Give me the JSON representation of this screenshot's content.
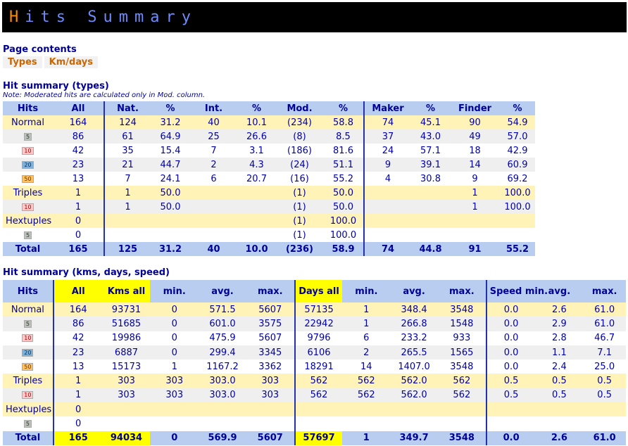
{
  "banner": {
    "title_first": "H",
    "title_rest": "its Summary"
  },
  "page_contents": {
    "heading": "Page contents",
    "tabs": [
      "Types",
      "Km/days"
    ]
  },
  "types": {
    "heading": "Hit summary (types)",
    "note": "Note: Moderated hits are calculated only in Mod. column.",
    "headers": [
      "Hits",
      "All",
      "Nat.",
      "%",
      "Int.",
      "%",
      "Mod.",
      "%",
      "Maker",
      "%",
      "Finder",
      "%"
    ],
    "rows": [
      {
        "label": "Normal",
        "badge": "",
        "style": "yellow",
        "cells": [
          "164",
          "124",
          "31.2",
          "40",
          "10.1",
          "(234)",
          "58.8",
          "74",
          "45.1",
          "90",
          "54.9"
        ]
      },
      {
        "label": "",
        "badge": "5",
        "style": "grey",
        "cells": [
          "86",
          "61",
          "64.9",
          "25",
          "26.6",
          "(8)",
          "8.5",
          "37",
          "43.0",
          "49",
          "57.0"
        ]
      },
      {
        "label": "",
        "badge": "10",
        "style": "white",
        "cells": [
          "42",
          "35",
          "15.4",
          "7",
          "3.1",
          "(186)",
          "81.6",
          "24",
          "57.1",
          "18",
          "42.9"
        ]
      },
      {
        "label": "",
        "badge": "20",
        "style": "grey",
        "cells": [
          "23",
          "21",
          "44.7",
          "2",
          "4.3",
          "(24)",
          "51.1",
          "9",
          "39.1",
          "14",
          "60.9"
        ]
      },
      {
        "label": "",
        "badge": "50",
        "style": "white",
        "cells": [
          "13",
          "7",
          "24.1",
          "6",
          "20.7",
          "(16)",
          "55.2",
          "4",
          "30.8",
          "9",
          "69.2"
        ]
      },
      {
        "label": "Triples",
        "badge": "",
        "style": "yellow",
        "cells": [
          "1",
          "1",
          "50.0",
          "",
          "",
          "(1)",
          "50.0",
          "",
          "",
          "1",
          "100.0"
        ]
      },
      {
        "label": "",
        "badge": "10",
        "style": "grey",
        "cells": [
          "1",
          "1",
          "50.0",
          "",
          "",
          "(1)",
          "50.0",
          "",
          "",
          "1",
          "100.0"
        ]
      },
      {
        "label": "Hextuples",
        "badge": "",
        "style": "yellow",
        "cells": [
          "0",
          "",
          "",
          "",
          "",
          "(1)",
          "100.0",
          "",
          "",
          "",
          ""
        ]
      },
      {
        "label": "",
        "badge": "5",
        "style": "white",
        "cells": [
          "0",
          "",
          "",
          "",
          "",
          "(1)",
          "100.0",
          "",
          "",
          "",
          ""
        ]
      }
    ],
    "total": {
      "label": "Total",
      "cells": [
        "165",
        "125",
        "31.2",
        "40",
        "10.0",
        "(236)",
        "58.9",
        "74",
        "44.8",
        "91",
        "55.2"
      ]
    }
  },
  "kms": {
    "heading": "Hit summary (kms, days, speed)",
    "headers": [
      "Hits",
      "All",
      "Kms all",
      "min.",
      "avg.",
      "max.",
      "Days all",
      "min.",
      "avg.",
      "max.",
      "Speed min.",
      "avg.",
      "max."
    ],
    "rows": [
      {
        "label": "Normal",
        "badge": "",
        "style": "yellow",
        "cells": [
          "164",
          "93731",
          "0",
          "571.5",
          "5607",
          "57135",
          "1",
          "348.4",
          "3548",
          "0.0",
          "2.6",
          "61.0"
        ]
      },
      {
        "label": "",
        "badge": "5",
        "style": "grey",
        "cells": [
          "86",
          "51685",
          "0",
          "601.0",
          "3575",
          "22942",
          "1",
          "266.8",
          "1548",
          "0.0",
          "2.9",
          "61.0"
        ]
      },
      {
        "label": "",
        "badge": "10",
        "style": "white",
        "cells": [
          "42",
          "19986",
          "0",
          "475.9",
          "5607",
          "9796",
          "6",
          "233.2",
          "933",
          "0.0",
          "2.8",
          "46.7"
        ]
      },
      {
        "label": "",
        "badge": "20",
        "style": "grey",
        "cells": [
          "23",
          "6887",
          "0",
          "299.4",
          "3345",
          "6106",
          "2",
          "265.5",
          "1565",
          "0.0",
          "1.1",
          "7.1"
        ]
      },
      {
        "label": "",
        "badge": "50",
        "style": "white",
        "cells": [
          "13",
          "15173",
          "1",
          "1167.2",
          "3362",
          "18291",
          "14",
          "1407.0",
          "3548",
          "0.0",
          "2.4",
          "25.0"
        ]
      },
      {
        "label": "Triples",
        "badge": "",
        "style": "yellow",
        "cells": [
          "1",
          "303",
          "303",
          "303.0",
          "303",
          "562",
          "562",
          "562.0",
          "562",
          "0.5",
          "0.5",
          "0.5"
        ]
      },
      {
        "label": "",
        "badge": "10",
        "style": "grey",
        "cells": [
          "1",
          "303",
          "303",
          "303.0",
          "303",
          "562",
          "562",
          "562.0",
          "562",
          "0.5",
          "0.5",
          "0.5"
        ]
      },
      {
        "label": "Hextuples",
        "badge": "",
        "style": "yellow",
        "cells": [
          "0",
          "",
          "",
          "",
          "",
          "",
          "",
          "",
          "",
          "",
          "",
          ""
        ]
      },
      {
        "label": "",
        "badge": "5",
        "style": "white",
        "cells": [
          "0",
          "",
          "",
          "",
          "",
          "",
          "",
          "",
          "",
          "",
          "",
          ""
        ]
      }
    ],
    "total": {
      "label": "Total",
      "cells": [
        "165",
        "94034",
        "0",
        "569.9",
        "5607",
        "57697",
        "1",
        "349.7",
        "3548",
        "0.0",
        "2.6",
        "61.0"
      ]
    }
  }
}
